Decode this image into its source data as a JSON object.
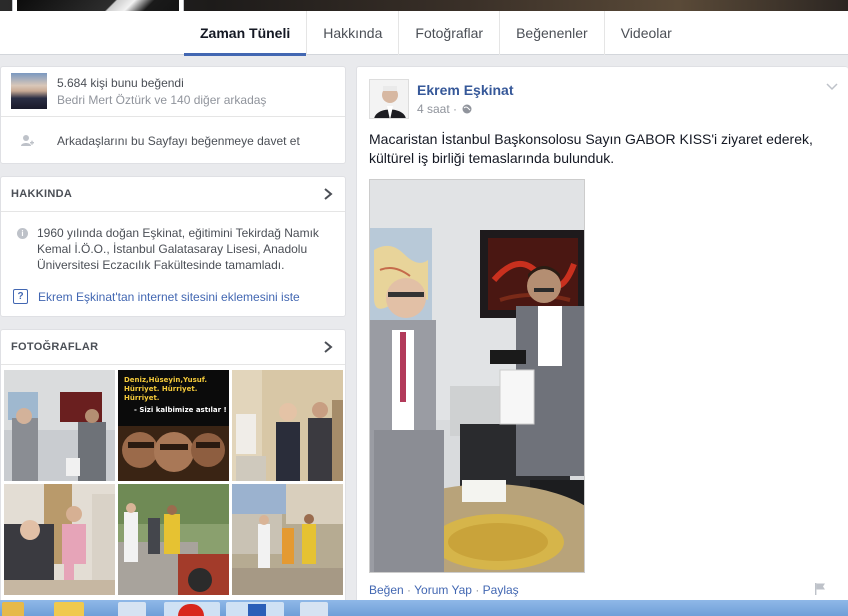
{
  "nav": {
    "tabs": [
      {
        "label": "Zaman Tüneli",
        "active": true
      },
      {
        "label": "Hakkında"
      },
      {
        "label": "Fotoğraflar"
      },
      {
        "label": "Beğenenler"
      },
      {
        "label": "Videolar"
      }
    ]
  },
  "likes": {
    "count_text": "5.684 kişi bunu beğendi",
    "friends_text": "Bedri Mert Öztürk ve 140 diğer arkadaş",
    "invite_text": "Arkadaşlarını bu Sayfayı beğenmeye davet et"
  },
  "about": {
    "header": "HAKKINDA",
    "description": "1960 yılında doğan Eşkinat, eğitimini Tekirdağ Namık Kemal İ.Ö.O., İstanbul Galatasaray Lisesi, Anadolu Üniversitesi Eczacılık Fakültesinde tamamladı.",
    "ask_link": "Ekrem Eşkinat'tan internet sitesini eklemesini iste"
  },
  "photos": {
    "header": "FOTOĞRAFLAR",
    "poster_lines": [
      "Deniz,Hüseyin,Yusuf.",
      "Hürriyet. Hürriyet. Hürriyet.",
      "- Sizi kalbimize astılar !"
    ]
  },
  "post": {
    "author": "Ekrem Eşkinat",
    "time": "4 saat ·",
    "text": "Macaristan İstanbul Başkonsolosu Sayın GABOR KISS'i ziyaret ederek, kültürel iş birliği temaslarında bulunduk.",
    "actions": {
      "like": "Beğen",
      "sep1": " · ",
      "comment": "Yorum Yap",
      "sep2": " · ",
      "share": "Paylaş"
    }
  },
  "colors": {
    "accent": "#4267b2",
    "link": "#365899",
    "background": "#e9eaed"
  }
}
